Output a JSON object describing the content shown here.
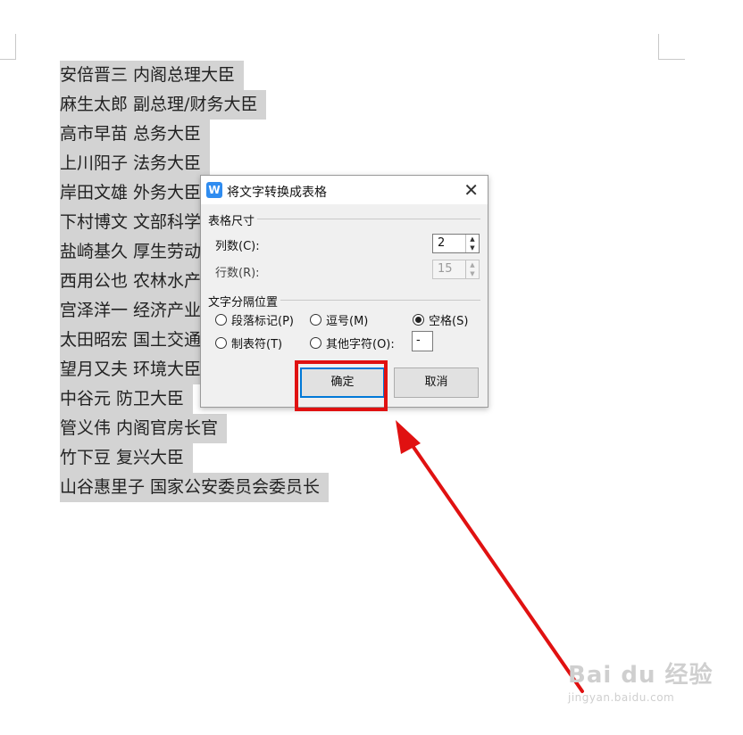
{
  "document": {
    "lines": [
      "安倍晋三  内阁总理大臣",
      "麻生太郎  副总理/财务大臣",
      "高市早苗  总务大臣",
      "上川阳子  法务大臣",
      "岸田文雄  外务大臣",
      "下村博文  文部科学大臣",
      "盐崎基久  厚生劳动大臣",
      "西用公也  农林水产大臣",
      "宫泽洋一  经济产业大臣",
      "太田昭宏  国土交通大臣",
      "望月又夫  环境大臣",
      "中谷元  防卫大臣",
      "管义伟  内阁官房长官",
      "竹下豆  复兴大臣",
      "山谷惠里子  国家公安委员会委员长"
    ]
  },
  "dialog": {
    "icon_text": "W",
    "title": "将文字转换成表格",
    "close_glyph": "✕",
    "table_size": {
      "label": "表格尺寸",
      "columns_label": "列数(C):",
      "columns_value": "2",
      "rows_label": "行数(R):",
      "rows_value": "15"
    },
    "separator": {
      "label": "文字分隔位置",
      "options": [
        {
          "label": "段落标记(P)",
          "checked": false
        },
        {
          "label": "逗号(M)",
          "checked": false
        },
        {
          "label": "空格(S)",
          "checked": true
        },
        {
          "label": "制表符(T)",
          "checked": false
        },
        {
          "label": "其他字符(O):",
          "checked": false
        }
      ],
      "other_char_value": "-"
    },
    "ok_label": "确定",
    "cancel_label": "取消"
  },
  "annotation": {
    "color": "#e01111"
  },
  "watermark": {
    "brand": "Bai du 经验",
    "url": "jingyan.baidu.com"
  }
}
